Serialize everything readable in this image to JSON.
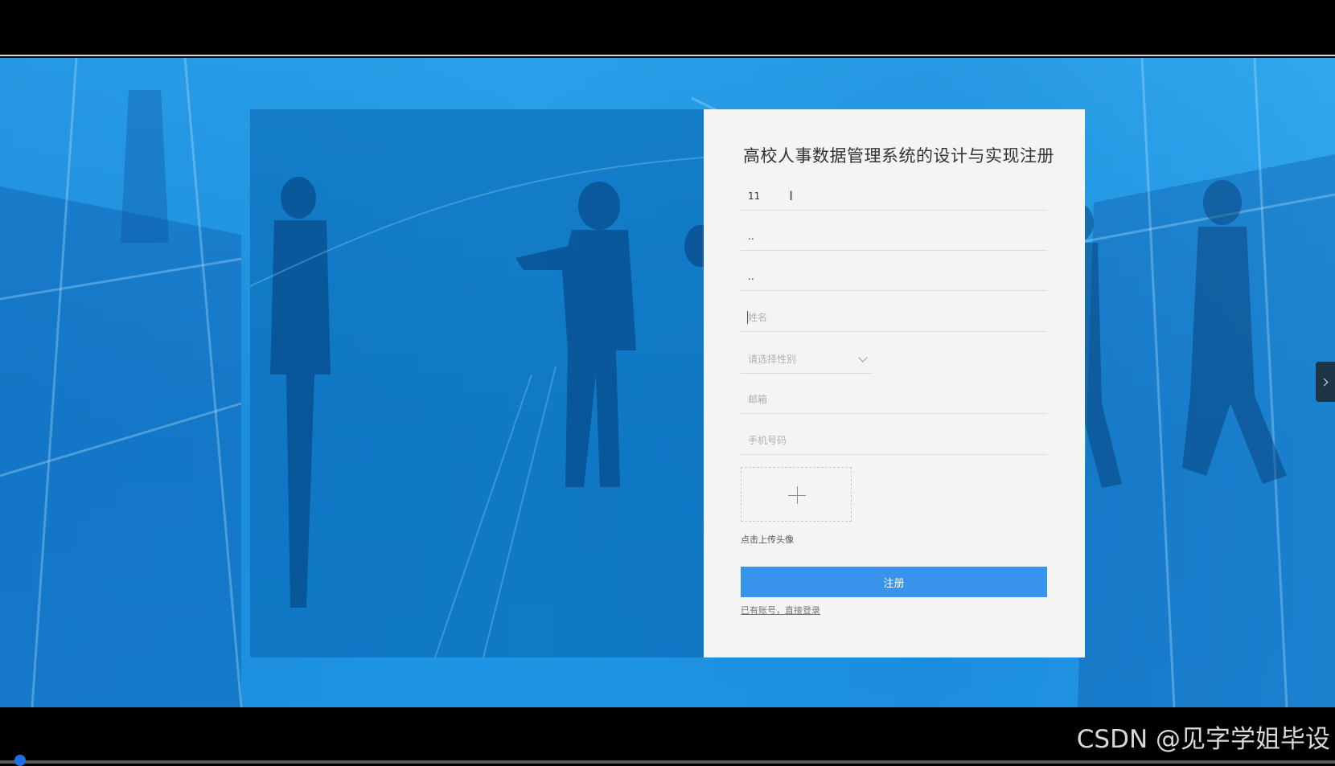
{
  "form": {
    "title": "高校人事数据管理系统的设计与实现注册",
    "username_value": "11",
    "password_value": "..",
    "confirm_password_value": "..",
    "name_placeholder": "姓名",
    "gender_placeholder": "请选择性别",
    "email_placeholder": "邮箱",
    "phone_placeholder": "手机号码",
    "upload_label": "点击上传头像",
    "register_button": "注册",
    "login_link": "已有账号，直接登录"
  },
  "icons": {
    "upload": "plus-icon",
    "select": "chevron-down-icon",
    "side_toggle": "chevron-right-icon"
  },
  "colors": {
    "primary_button": "#3a93ec",
    "background": "#1f9be6",
    "card": "#f4f4f4"
  },
  "watermark": "CSDN @见字学姐毕设"
}
